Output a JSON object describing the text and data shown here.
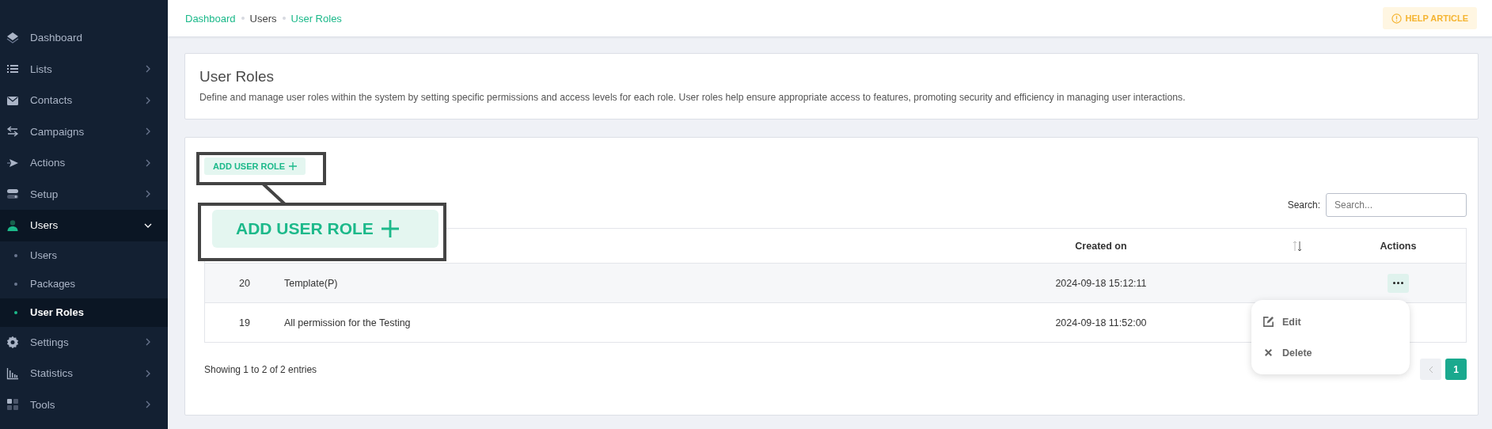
{
  "sidebar": {
    "items": [
      {
        "label": "Dashboard",
        "kind": "link",
        "selected": false
      },
      {
        "label": "Lists",
        "kind": "group",
        "selected": false,
        "expanded": false
      },
      {
        "label": "Contacts",
        "kind": "group",
        "selected": false,
        "expanded": false
      },
      {
        "label": "Campaigns",
        "kind": "group",
        "selected": false,
        "expanded": false
      },
      {
        "label": "Actions",
        "kind": "group",
        "selected": false,
        "expanded": false
      },
      {
        "label": "Setup",
        "kind": "group",
        "selected": false,
        "expanded": false
      },
      {
        "label": "Users",
        "kind": "group",
        "selected": true,
        "expanded": true,
        "children": [
          {
            "label": "Users",
            "selected": false
          },
          {
            "label": "Packages",
            "selected": false
          },
          {
            "label": "User Roles",
            "selected": true
          }
        ]
      },
      {
        "label": "Settings",
        "kind": "group",
        "selected": false,
        "expanded": false
      },
      {
        "label": "Statistics",
        "kind": "group",
        "selected": false,
        "expanded": false
      },
      {
        "label": "Tools",
        "kind": "group",
        "selected": false,
        "expanded": false
      }
    ]
  },
  "breadcrumb": [
    {
      "label": "Dashboard",
      "kind": "link"
    },
    {
      "label": "Users",
      "kind": "plain"
    },
    {
      "label": "User Roles",
      "kind": "link"
    }
  ],
  "help_button": {
    "label": "HELP ARTICLE"
  },
  "intro": {
    "title": "User Roles",
    "description": "Define and manage user roles within the system by setting specific permissions and access levels for each role. User roles help ensure appropriate access to features, promoting security and efficiency in managing user interactions."
  },
  "add_button": {
    "label": "ADD USER ROLE"
  },
  "callout": {
    "label": "ADD USER ROLE"
  },
  "search": {
    "label": "Search:",
    "placeholder": "Search..."
  },
  "table": {
    "columns": [
      "Created on",
      "Actions"
    ],
    "rows": [
      {
        "id": "20",
        "name": "Template(P)",
        "created_on": "2024-09-18 15:12:11",
        "menu_open": true
      },
      {
        "id": "19",
        "name": "All permission for the Testing",
        "created_on": "2024-09-18 11:52:00"
      }
    ]
  },
  "row_menu": [
    {
      "label": "Edit",
      "kind": "edit"
    },
    {
      "label": "Delete",
      "kind": "delete"
    }
  ],
  "footer": {
    "info": "Showing 1 to 2 of 2 entries",
    "pages": [
      {
        "label": "1",
        "selected": true
      }
    ]
  }
}
